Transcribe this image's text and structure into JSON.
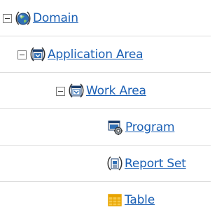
{
  "tree": {
    "items": [
      {
        "label": "Domain",
        "icon": "domain-icon"
      },
      {
        "label": "Application Area",
        "icon": "application-area-icon"
      },
      {
        "label": "Work Area",
        "icon": "work-area-icon"
      },
      {
        "label": "Program",
        "icon": "program-icon"
      },
      {
        "label": "Report Set",
        "icon": "report-set-icon"
      },
      {
        "label": "Table",
        "icon": "table-icon"
      }
    ]
  },
  "colors": {
    "link": "#1a5fb4",
    "row_divider": "#dcdcdc",
    "table_icon": "#e8a400"
  }
}
